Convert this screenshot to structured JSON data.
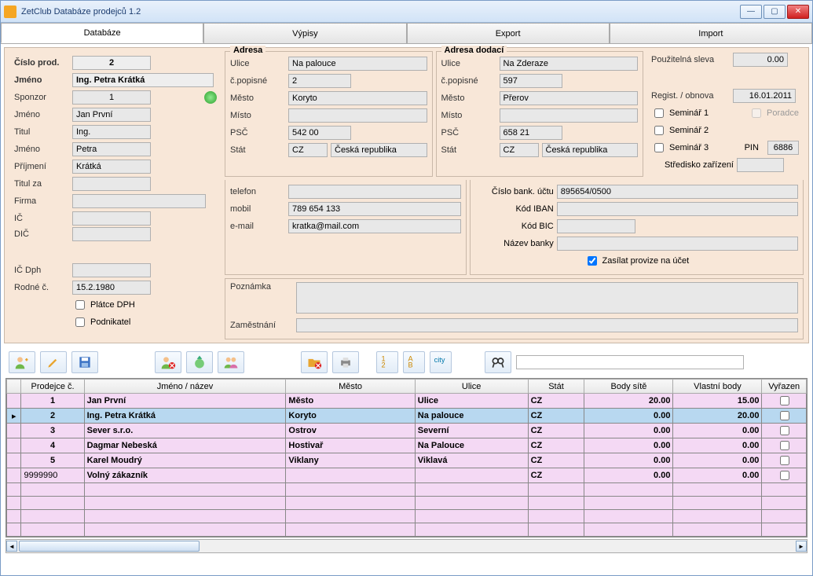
{
  "window": {
    "title": "ZetClub Databáze prodejců 1.2"
  },
  "tabs": {
    "databaze": "Databáze",
    "vypisy": "Výpisy",
    "export": "Export",
    "import": "Import"
  },
  "left": {
    "cislo_prod_lbl": "Číslo prod.",
    "cislo_prod": "2",
    "jmeno_full_lbl": "Jméno",
    "jmeno_full": "Ing. Petra Krátká",
    "sponzor_lbl": "Sponzor",
    "sponzor": "1",
    "jmeno_sponzor_lbl": "Jméno",
    "jmeno_sponzor": "Jan První",
    "titul_lbl": "Titul",
    "titul": "Ing.",
    "jmeno_lbl": "Jméno",
    "jmeno": "Petra",
    "prijmeni_lbl": "Příjmení",
    "prijmeni": "Krátká",
    "titul_za_lbl": "Titul za",
    "titul_za": "",
    "firma_lbl": "Firma",
    "firma": "",
    "ic_lbl": "IČ",
    "ic": "",
    "dic_lbl": "DIČ",
    "dic": "",
    "ic_dph_lbl": "IČ Dph",
    "ic_dph": "",
    "rodne_lbl": "Rodné č.",
    "rodne": "15.2.1980",
    "platce_dph_lbl": "Plátce DPH",
    "podnikatel_lbl": "Podnikatel"
  },
  "adresa": {
    "title": "Adresa",
    "ulice_lbl": "Ulice",
    "ulice": "Na palouce",
    "cpopisne_lbl": "č.popisné",
    "cpopisne": "2",
    "mesto_lbl": "Město",
    "mesto": "Koryto",
    "misto_lbl": "Místo",
    "misto": "",
    "psc_lbl": "PSČ",
    "psc": "542 00",
    "stat_lbl": "Stát",
    "stat_code": "CZ",
    "stat_name": "Česká republika",
    "telefon_lbl": "telefon",
    "telefon": "",
    "mobil_lbl": "mobil",
    "mobil": "789 654 133",
    "email_lbl": "e-mail",
    "email": "kratka@mail.com"
  },
  "dodaci": {
    "title": "Adresa dodací",
    "ulice_lbl": "Ulice",
    "ulice": "Na Zderaze",
    "cpopisne_lbl": "č.popisné",
    "cpopisne": "597",
    "mesto_lbl": "Město",
    "mesto": "Přerov",
    "misto_lbl": "Místo",
    "misto": "",
    "psc_lbl": "PSČ",
    "psc": "658 21",
    "stat_lbl": "Stát",
    "stat_code": "CZ",
    "stat_name": "Česká republika"
  },
  "bank": {
    "cislo_lbl": "Číslo bank. účtu",
    "cislo": "895654/0500",
    "iban_lbl": "Kód IBAN",
    "iban": "",
    "bic_lbl": "Kód BIC",
    "bic": "",
    "nazev_lbl": "Název banky",
    "nazev": "",
    "zasilat_lbl": "Zasílat provize na účet"
  },
  "right": {
    "sleva_lbl": "Použitelná sleva",
    "sleva": "0.00",
    "regist_lbl": "Regist. / obnova",
    "regist": "16.01.2011",
    "seminar1_lbl": "Seminář 1",
    "seminar2_lbl": "Seminář 2",
    "seminar3_lbl": "Seminář 3",
    "poradce_lbl": "Poradce",
    "pin_lbl": "PIN",
    "pin": "6886",
    "stredisko_lbl": "Středisko zařízení",
    "stredisko": ""
  },
  "poznamka_lbl": "Poznámka",
  "zamestnani_lbl": "Zaměstnání",
  "grid": {
    "headers": {
      "prodejce": "Prodejce č.",
      "jmeno": "Jméno / název",
      "mesto": "Město",
      "ulice": "Ulice",
      "stat": "Stát",
      "body_site": "Body sítě",
      "vlastni_body": "Vlastní body",
      "vyrazen": "Vyřazen"
    },
    "rows": [
      {
        "c": "1",
        "jmeno": "Jan  První",
        "mesto": "Město",
        "ulice": "Ulice",
        "stat": "CZ",
        "bs": "20.00",
        "vb": "15.00"
      },
      {
        "c": "2",
        "jmeno": "Ing. Petra  Krátká",
        "mesto": "Koryto",
        "ulice": "Na palouce",
        "stat": "CZ",
        "bs": "0.00",
        "vb": "20.00"
      },
      {
        "c": "3",
        "jmeno": "Sever s.r.o.",
        "mesto": "Ostrov",
        "ulice": "Severní",
        "stat": "CZ",
        "bs": "0.00",
        "vb": "0.00"
      },
      {
        "c": "4",
        "jmeno": "Dagmar  Nebeská",
        "mesto": "Hostivař",
        "ulice": "Na Palouce",
        "stat": "CZ",
        "bs": "0.00",
        "vb": "0.00"
      },
      {
        "c": "5",
        "jmeno": "Karel  Moudrý",
        "mesto": "Viklany",
        "ulice": "Viklavá",
        "stat": "CZ",
        "bs": "0.00",
        "vb": "0.00"
      },
      {
        "c": "9999990",
        "jmeno": "Volný zákazník",
        "mesto": "",
        "ulice": "",
        "stat": "CZ",
        "bs": "0.00",
        "vb": "0.00"
      }
    ]
  }
}
